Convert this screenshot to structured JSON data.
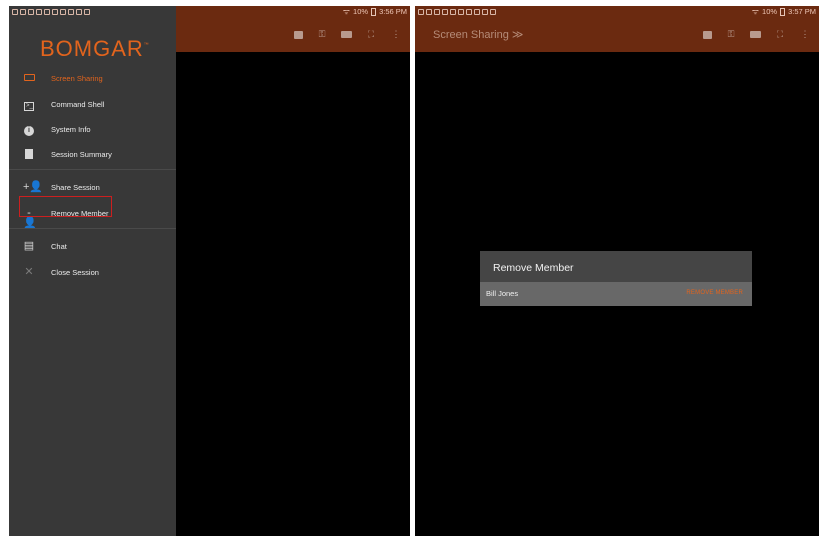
{
  "colors": {
    "accent": "#e2641d",
    "appbar": "#6b2a10",
    "drawer": "#383838",
    "dialog": "#454545",
    "dialog_row": "#686868",
    "highlight": "#cc1f1f"
  },
  "left": {
    "status": {
      "time": "3:56 PM",
      "battery": "10%"
    },
    "drawer": {
      "logo": "BOMGAR",
      "logo_tm": "™",
      "items": [
        {
          "label": "Screen Sharing",
          "icon": "monitor-icon",
          "active": true
        },
        {
          "label": "Command Shell",
          "icon": "terminal-icon"
        },
        {
          "label": "System Info",
          "icon": "info-icon"
        },
        {
          "label": "Session Summary",
          "icon": "document-icon"
        },
        {
          "label": "Share Session",
          "icon": "add-person-icon"
        },
        {
          "label": "Remove Member",
          "icon": "remove-person-icon",
          "highlighted": true
        },
        {
          "label": "Chat",
          "icon": "chat-icon"
        },
        {
          "label": "Close Session",
          "icon": "close-icon"
        }
      ]
    },
    "toolbar": [
      "stop-icon",
      "key-icon",
      "keyboard-icon",
      "fullscreen-icon",
      "more-icon"
    ]
  },
  "right": {
    "status": {
      "time": "3:57 PM",
      "battery": "10%"
    },
    "title": "Screen Sharing",
    "toolbar": [
      "stop-icon",
      "key-icon",
      "keyboard-icon",
      "fullscreen-icon",
      "more-icon"
    ],
    "dialog": {
      "title": "Remove Member",
      "member": "Bill Jones",
      "action": "REMOVE MEMBER"
    }
  }
}
